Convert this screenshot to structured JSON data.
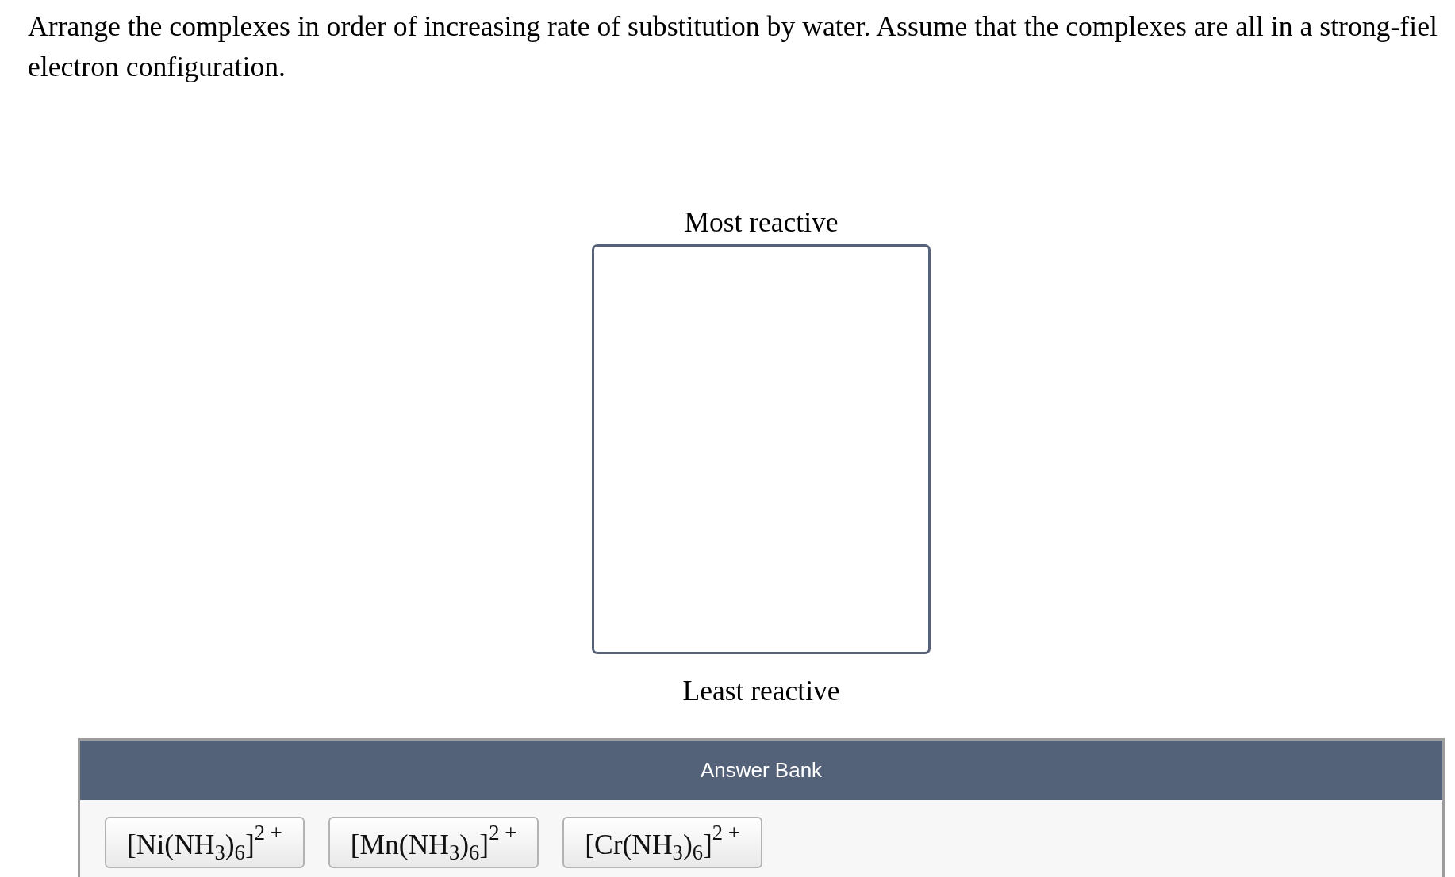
{
  "question": {
    "lines": [
      "Arrange the complexes in order of increasing rate of substitution by water. Assume that the complexes are all in a strong-fiel",
      "electron configuration."
    ]
  },
  "ranking": {
    "top_label": "Most reactive",
    "bottom_label": "Least reactive"
  },
  "answer_bank": {
    "title": "Answer Bank",
    "items": [
      {
        "label": "[Ni(NH$_{3}$)$_{6}$]$^{2 +}$"
      },
      {
        "label": "[Mn(NH$_{3}$)$_{6}$]$^{2 +}$"
      },
      {
        "label": "[Cr(NH$_{3}$)$_{6}$]$^{2 +}$"
      }
    ]
  }
}
